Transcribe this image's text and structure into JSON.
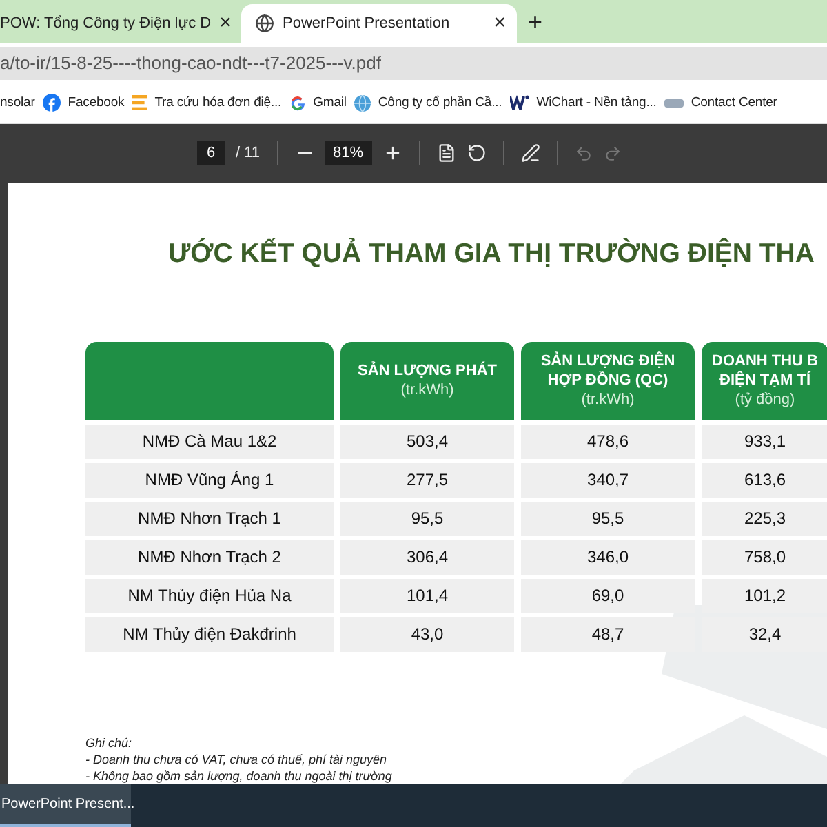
{
  "tabs": [
    {
      "title": "POW: Tổng Công ty Điện lực D",
      "selected": false,
      "close": "×"
    },
    {
      "title": "PowerPoint Presentation",
      "selected": true,
      "close": "×"
    }
  ],
  "new_tab": "+",
  "address": "a/to-ir/15-8-25----thong-cao-ndt---t7-2025---v.pdf",
  "bookmarks": [
    {
      "label": "nsolar",
      "kind": "none"
    },
    {
      "label": "Facebook",
      "kind": "facebook"
    },
    {
      "label": "Tra cứu hóa đơn điệ...",
      "kind": "invoice"
    },
    {
      "label": "Gmail",
      "kind": "google"
    },
    {
      "label": "Công ty cổ phần Cầ...",
      "kind": "globe"
    },
    {
      "label": "WiChart - Nền tảng...",
      "kind": "wichart"
    },
    {
      "label": "Contact Center",
      "kind": "contact"
    }
  ],
  "pdf_toolbar": {
    "page": "6",
    "page_count": "/ 11",
    "zoom": "81%",
    "undo_disabled": true,
    "redo_disabled": true
  },
  "slide": {
    "title": "ƯỚC KẾT QUẢ THAM GIA THỊ TRƯỜNG ĐIỆN THA",
    "columns": [
      {},
      {
        "lines": [
          "SẢN LƯỢNG PHÁT"
        ],
        "unit": "(tr.kWh)"
      },
      {
        "lines": [
          "SẢN LƯỢNG ĐIỆN",
          "HỢP ĐỒNG (QC)"
        ],
        "unit": "(tr.kWh)"
      },
      {
        "lines": [
          "DOANH THU B",
          "ĐIỆN TẠM TÍ"
        ],
        "unit": "(tỷ đồng)"
      }
    ],
    "rows": [
      {
        "name": "NMĐ Cà Mau 1&2",
        "values": [
          "503,4",
          "478,6",
          "933,1"
        ]
      },
      {
        "name": "NMĐ Vũng Áng 1",
        "values": [
          "277,5",
          "340,7",
          "613,6"
        ]
      },
      {
        "name": "NMĐ Nhơn Trạch 1",
        "values": [
          "95,5",
          "95,5",
          "225,3"
        ]
      },
      {
        "name": "NMĐ Nhơn Trạch 2",
        "values": [
          "306,4",
          "346,0",
          "758,0"
        ]
      },
      {
        "name": "NM Thủy điện Hủa Na",
        "values": [
          "101,4",
          "69,0",
          "101,2"
        ]
      },
      {
        "name": "NM Thủy điện Đakđrinh",
        "values": [
          "43,0",
          "48,7",
          "32,4"
        ]
      }
    ],
    "notes_title": "Ghi chú:",
    "notes": [
      "- Doanh thu chưa có VAT, chưa có thuế, phí tài nguyên",
      "- Không bao gồm sản lượng, doanh thu ngoài thị trường"
    ]
  },
  "taskbar": [
    {
      "label": "PowerPoint Present...",
      "selected": true
    }
  ]
}
